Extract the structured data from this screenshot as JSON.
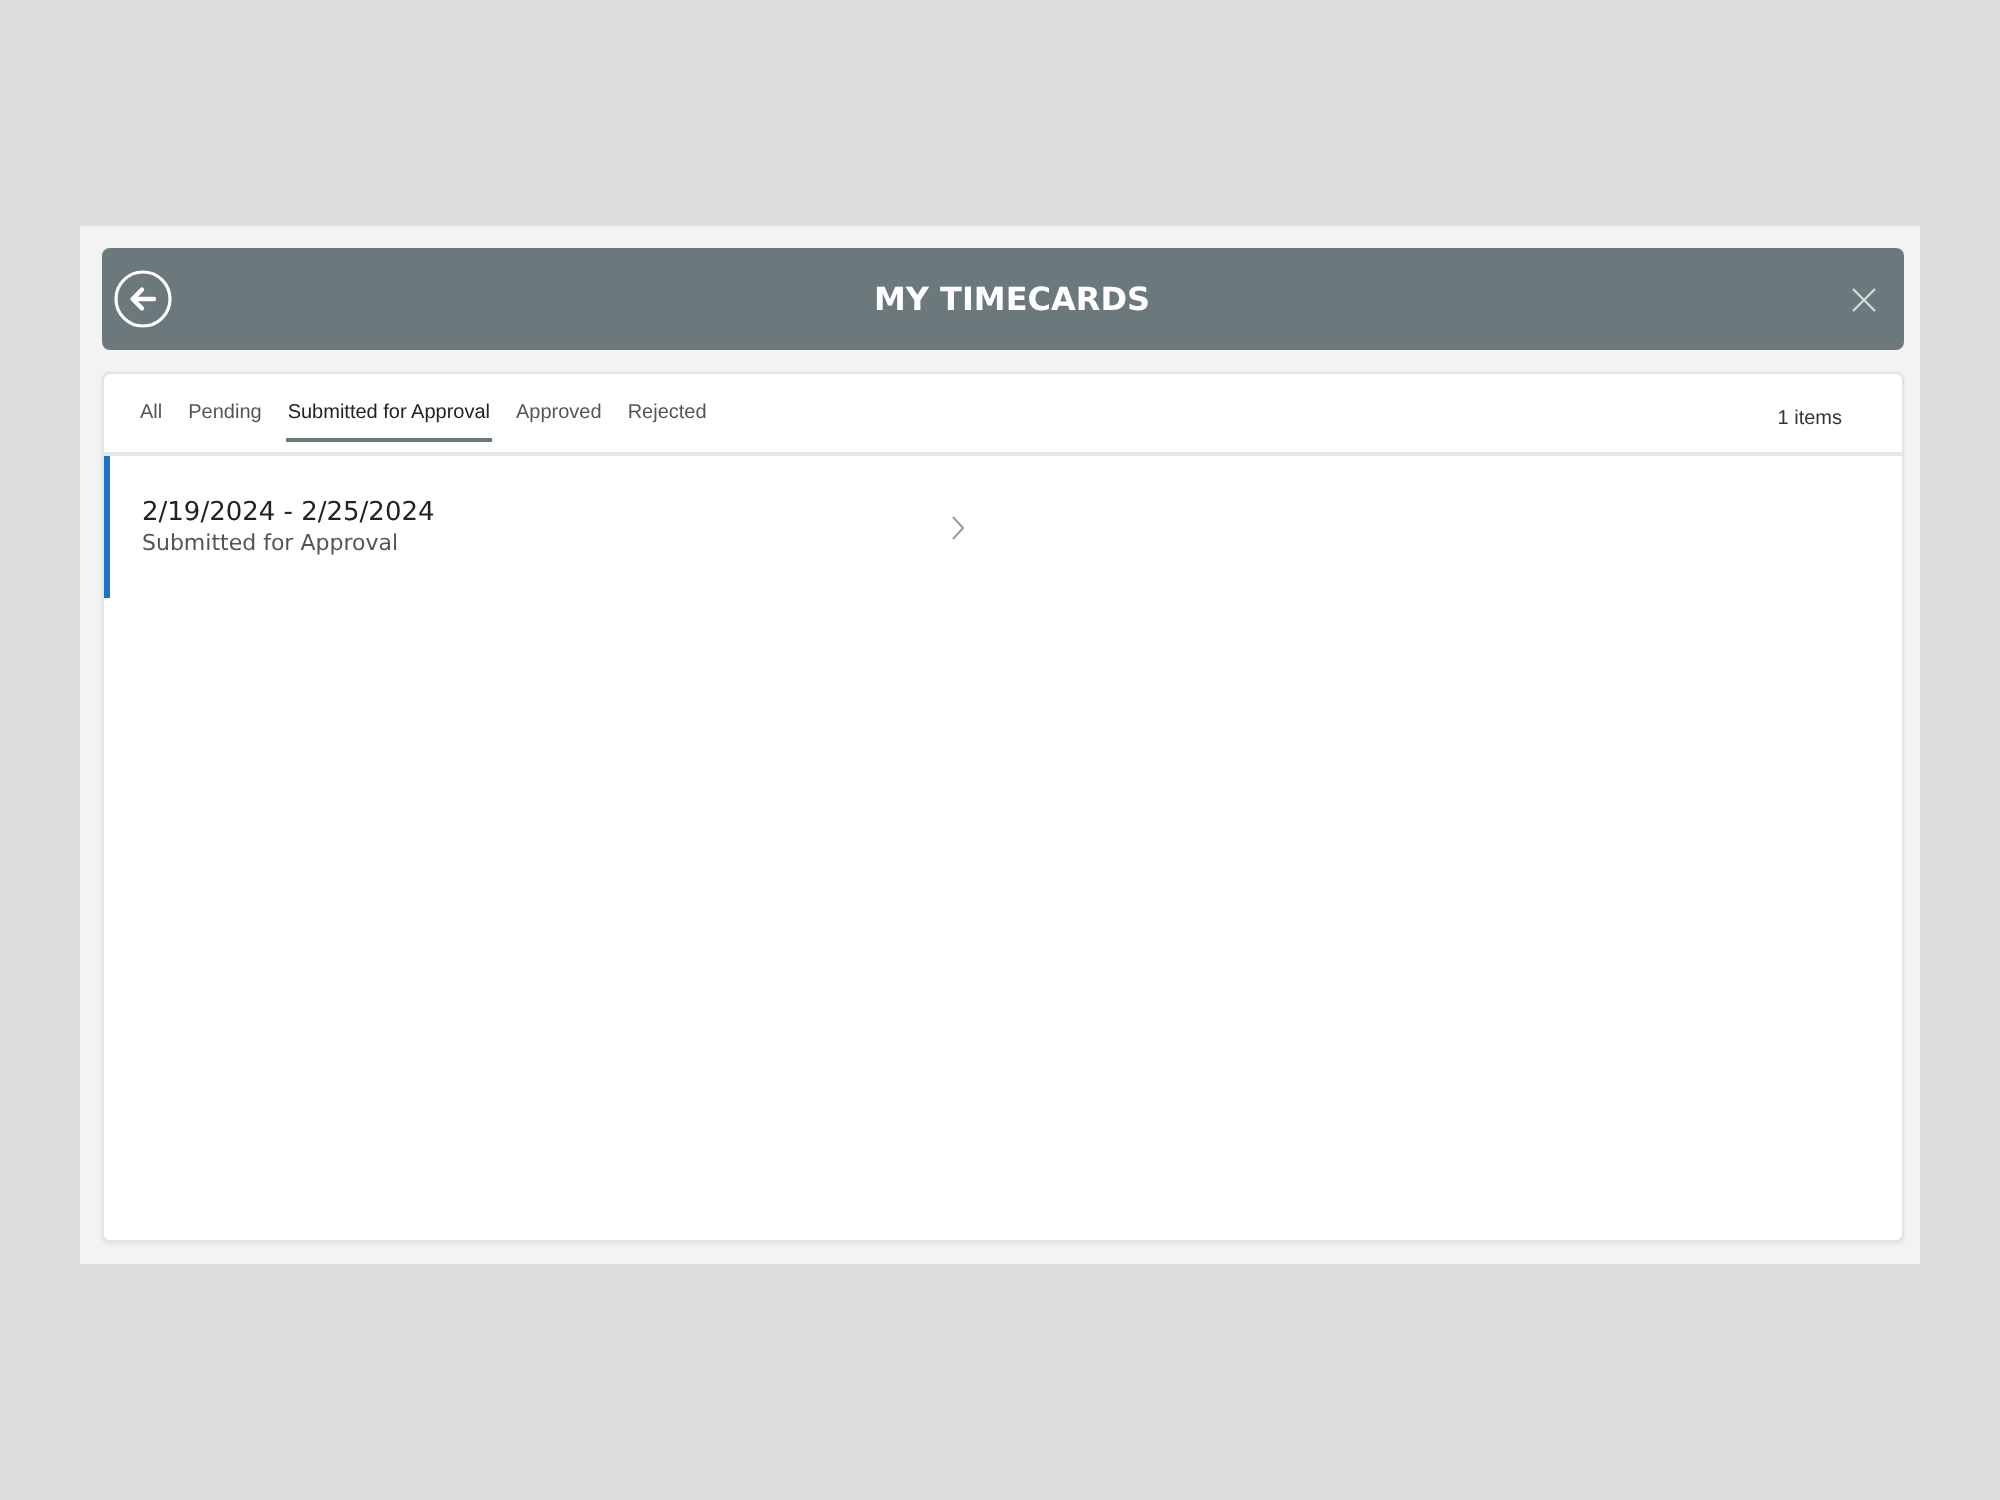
{
  "header": {
    "title": "MY TIMECARDS"
  },
  "tabs": [
    {
      "label": "All",
      "selected": false
    },
    {
      "label": "Pending",
      "selected": false
    },
    {
      "label": "Submitted for Approval",
      "selected": true
    },
    {
      "label": "Approved",
      "selected": false
    },
    {
      "label": "Rejected",
      "selected": false
    }
  ],
  "item_count": "1 items",
  "timecards": [
    {
      "period": "2/19/2024 - 2/25/2024",
      "status": "Submitted for Approval",
      "selected": true
    }
  ]
}
